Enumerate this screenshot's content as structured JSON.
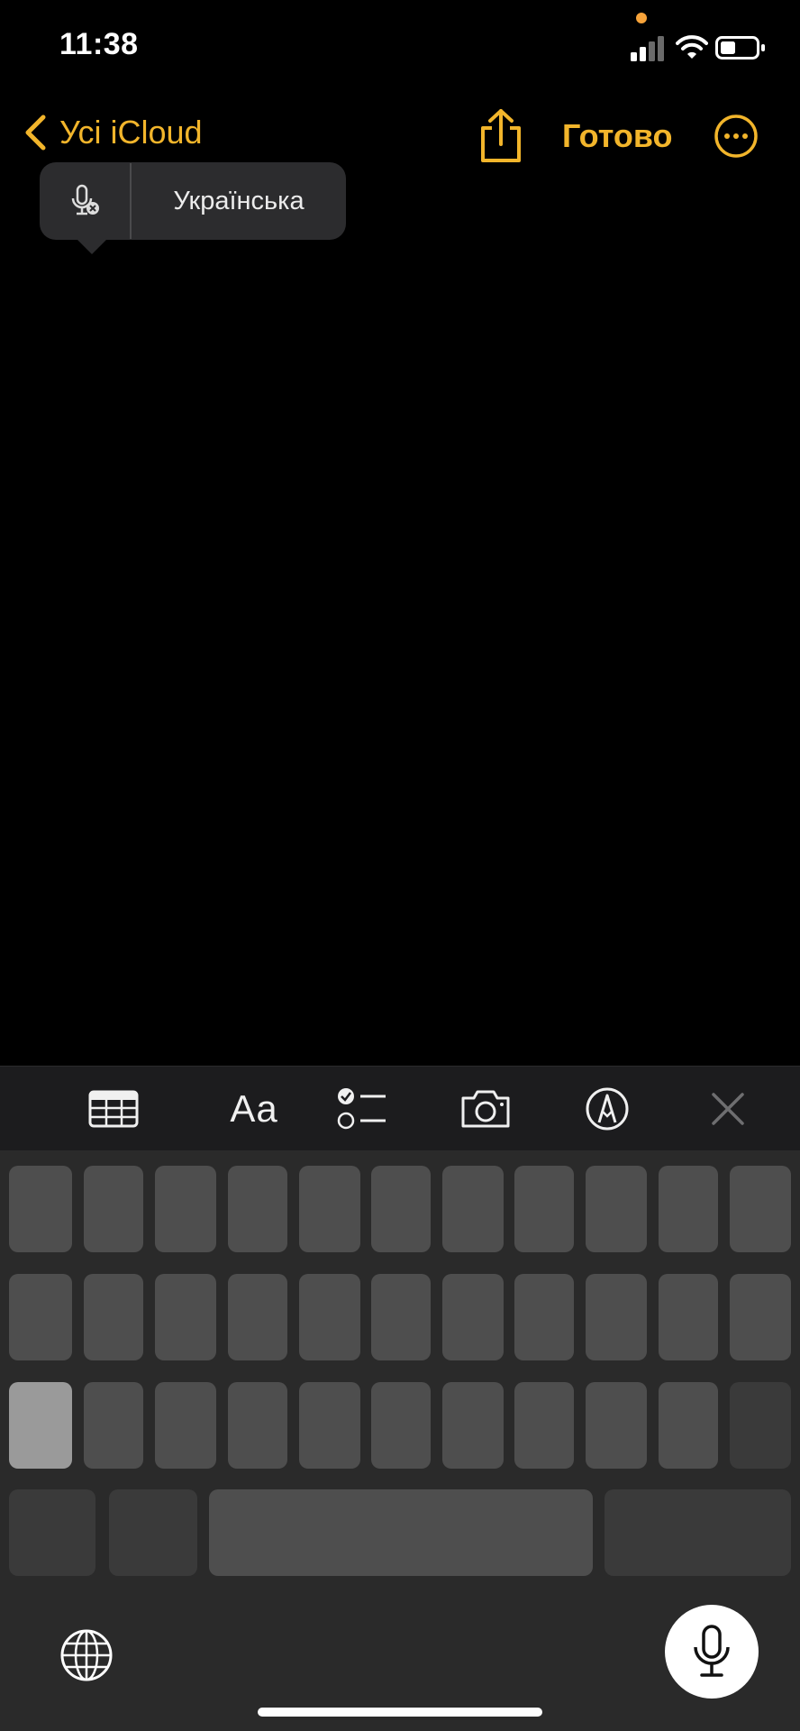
{
  "status_bar": {
    "time": "11:38"
  },
  "nav": {
    "back_label": "Усі iCloud",
    "done_label": "Готово"
  },
  "dictation": {
    "language": "Українська"
  },
  "toolbar": {
    "format_label": "Aa"
  },
  "colors": {
    "accent": "#f2b52b",
    "mic_indicator": "#f7a33a",
    "background": "#000000",
    "keyboard": "#2a2a2a",
    "key": "#4e4e4e"
  },
  "icons": {
    "back": "chevron-left-icon",
    "share": "share-icon",
    "more": "ellipsis-circle-icon",
    "dictation_mic": "mic-slash-icon",
    "table": "table-icon",
    "checklist": "checklist-icon",
    "camera": "camera-icon",
    "markup": "pen-circle-icon",
    "close": "close-icon",
    "globe": "globe-icon",
    "mic": "mic-icon"
  }
}
